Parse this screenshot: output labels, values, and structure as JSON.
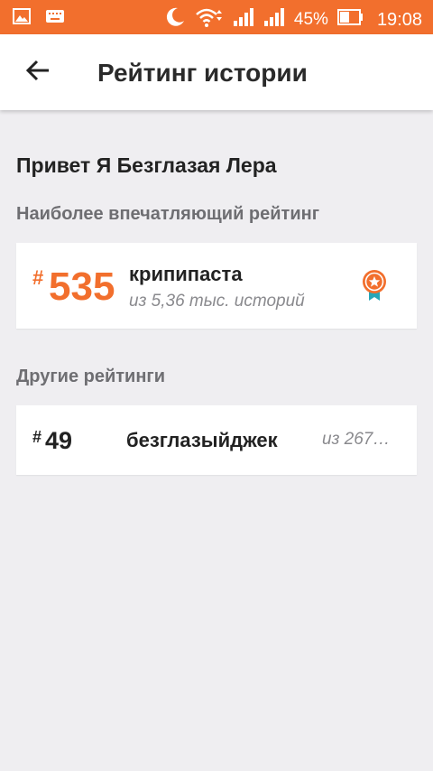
{
  "status_bar": {
    "battery": "45%",
    "time": "19:08"
  },
  "app_bar": {
    "back_icon": "arrow-back-icon",
    "title": "Рейтинг истории"
  },
  "greeting": "Привет Я Безглазая Лера",
  "main_section": {
    "title": "Наиболее впечатляющий рейтинг",
    "rank": {
      "hash": "#",
      "number": "535",
      "tag": "крипипаста",
      "subtitle": "из 5,36 тыс. историй",
      "badge_icon": "award-ribbon-icon"
    }
  },
  "other_section": {
    "title": "Другие рейтинги",
    "ranks": [
      {
        "hash": "#",
        "number": "49",
        "tag": "безглазыйджек",
        "subtitle": "из 267…"
      }
    ]
  },
  "colors": {
    "accent": "#f26f2d",
    "badge_ribbon": "#26a6b8",
    "background": "#efeef1"
  }
}
